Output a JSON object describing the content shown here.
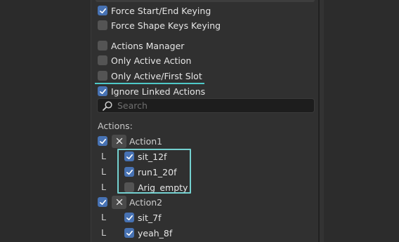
{
  "options": {
    "force_start_end": {
      "label": "Force Start/End Keying",
      "checked": true
    },
    "force_shape_keys": {
      "label": "Force Shape Keys Keying",
      "checked": false
    },
    "actions_manager": {
      "label": "Actions Manager",
      "checked": false
    },
    "only_active_action": {
      "label": "Only Active Action",
      "checked": false
    },
    "only_active_first_slot": {
      "label": "Only Active/First Slot",
      "checked": false
    },
    "ignore_linked_actions": {
      "label": "Ignore Linked Actions",
      "checked": true
    }
  },
  "search": {
    "placeholder": "Search"
  },
  "actions_section": {
    "label": "Actions:",
    "actions": [
      {
        "name": "Action1",
        "checked": true,
        "slots": [
          {
            "prefix": "L",
            "name": "sit_12f",
            "checked": true
          },
          {
            "prefix": "L",
            "name": "run1_20f",
            "checked": true
          },
          {
            "prefix": "L",
            "name": "Arig_empty",
            "checked": false
          }
        ]
      },
      {
        "name": "Action2",
        "checked": true,
        "slots": [
          {
            "prefix": "L",
            "name": "sit_7f",
            "checked": true
          },
          {
            "prefix": "L",
            "name": "yeah_8f",
            "checked": true
          }
        ]
      }
    ]
  },
  "colors": {
    "accent": "#4772b3",
    "highlight": "#74d1d0",
    "underline": "#4ec9c8"
  }
}
